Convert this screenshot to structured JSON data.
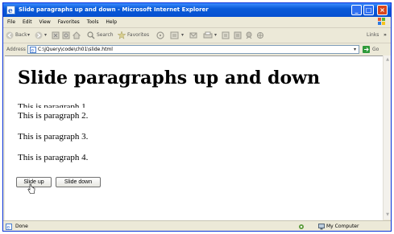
{
  "window": {
    "title": "Slide paragraphs up and down - Microsoft Internet Explorer",
    "minimize": "_",
    "maximize": "□",
    "close": "×"
  },
  "menubar": {
    "items": [
      "File",
      "Edit",
      "View",
      "Favorites",
      "Tools",
      "Help"
    ]
  },
  "toolbar": {
    "back_label": "Back",
    "search_label": "Search",
    "favorites_label": "Favorites",
    "links_label": "Links"
  },
  "address": {
    "label": "Address",
    "value": "C:\\jQuery\\code\\ch01\\slide.html",
    "go_label": "Go"
  },
  "page": {
    "heading": "Slide paragraphs up and down",
    "paragraphs": [
      "This is paragraph 1.",
      "This is paragraph 2.",
      "This is paragraph 3.",
      "This is paragraph 4."
    ],
    "slide_up_label": "Slide up",
    "slide_down_label": "Slide down"
  },
  "status": {
    "text": "Done",
    "zone": "My Computer"
  },
  "colors": {
    "titlebar": "#0a5ad8",
    "chrome": "#ece9d8"
  }
}
